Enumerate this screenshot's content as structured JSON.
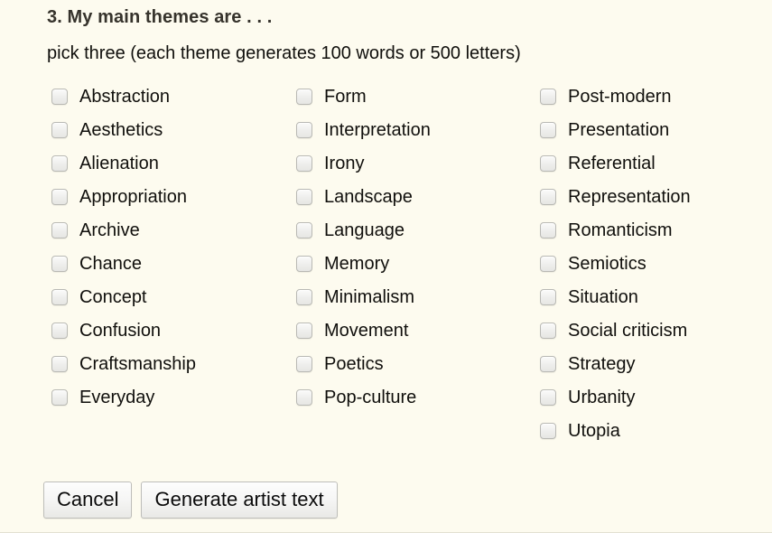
{
  "form": {
    "heading": "3. My main themes are . . .",
    "subheading": "pick three (each theme generates 100 words or 500 letters)",
    "columns": [
      {
        "options": [
          {
            "label": "Abstraction",
            "checked": false
          },
          {
            "label": "Aesthetics",
            "checked": false
          },
          {
            "label": "Alienation",
            "checked": false
          },
          {
            "label": "Appropriation",
            "checked": false
          },
          {
            "label": "Archive",
            "checked": false
          },
          {
            "label": "Chance",
            "checked": false
          },
          {
            "label": "Concept",
            "checked": false
          },
          {
            "label": "Confusion",
            "checked": false
          },
          {
            "label": "Craftsmanship",
            "checked": false
          },
          {
            "label": "Everyday",
            "checked": false
          }
        ]
      },
      {
        "options": [
          {
            "label": "Form",
            "checked": false
          },
          {
            "label": "Interpretation",
            "checked": false
          },
          {
            "label": "Irony",
            "checked": false
          },
          {
            "label": "Landscape",
            "checked": false
          },
          {
            "label": "Language",
            "checked": false
          },
          {
            "label": "Memory",
            "checked": false
          },
          {
            "label": "Minimalism",
            "checked": false
          },
          {
            "label": "Movement",
            "checked": false
          },
          {
            "label": "Poetics",
            "checked": false
          },
          {
            "label": "Pop-culture",
            "checked": false
          }
        ]
      },
      {
        "options": [
          {
            "label": "Post-modern",
            "checked": false
          },
          {
            "label": "Presentation",
            "checked": false
          },
          {
            "label": "Referential",
            "checked": false
          },
          {
            "label": "Representation",
            "checked": false
          },
          {
            "label": "Romanticism",
            "checked": false
          },
          {
            "label": "Semiotics",
            "checked": false
          },
          {
            "label": "Situation",
            "checked": false
          },
          {
            "label": "Social criticism",
            "checked": false
          },
          {
            "label": "Strategy",
            "checked": false
          },
          {
            "label": "Urbanity",
            "checked": false
          },
          {
            "label": "Utopia",
            "checked": false
          }
        ]
      }
    ],
    "buttons": [
      {
        "label": "Cancel",
        "name": "cancel-button"
      },
      {
        "label": "Generate artist text",
        "name": "generate-artist-text-button"
      }
    ]
  },
  "colors": {
    "page_background": "#fdfbef",
    "heading_text": "#36332c",
    "body_text": "#100f0c",
    "checkbox_border": "#b9b9b4",
    "button_border": "#bdbdb9"
  }
}
